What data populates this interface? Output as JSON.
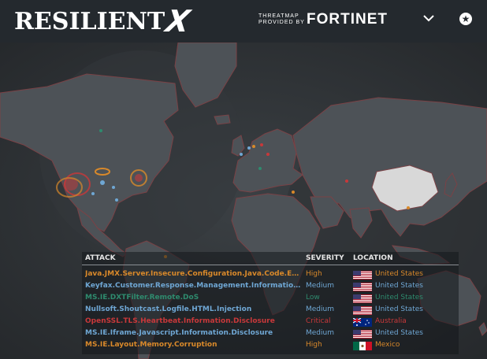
{
  "header": {
    "logo_text": "RESILIENT",
    "logo_x": "X",
    "provided_line1": "THREATMAP",
    "provided_line2": "PROVIDED BY",
    "brand": "FORTINET",
    "menu_icon": "chevron-down-icon",
    "badge_icon": "star-badge-icon"
  },
  "table": {
    "headers": [
      "ATTACK",
      "SEVERITY",
      "LOCATION"
    ],
    "rows": [
      {
        "attack": "Java.JMX.Server.Insecure.Configuration.Java.Code.Execution",
        "severity": "High",
        "location": "United States",
        "flag": "us",
        "color": "#d9892a"
      },
      {
        "attack": "Keyfax.Customer.Response.Management.Information.Disclosure",
        "severity": "Medium",
        "location": "United States",
        "flag": "us",
        "color": "#6fa7d4"
      },
      {
        "attack": "MS.IE.DXTFilter.Remote.DoS",
        "severity": "Low",
        "location": "United States",
        "flag": "us",
        "color": "#2e8b6e"
      },
      {
        "attack": "Nullsoft.Shoutcast.Logfile.HTML.Injection",
        "severity": "Medium",
        "location": "United States",
        "flag": "us",
        "color": "#6fa7d4"
      },
      {
        "attack": "OpenSSL.TLS.Heartbeat.Information.Disclosure",
        "severity": "Critical",
        "location": "Australia",
        "flag": "au",
        "color": "#c8383a"
      },
      {
        "attack": "MS.IE.Iframe.Javascript.Information.Disclosure",
        "severity": "Medium",
        "location": "United States",
        "flag": "us",
        "color": "#6fa7d4"
      },
      {
        "attack": "MS.IE.Layout.Memory.Corruption",
        "severity": "High",
        "location": "Mexico",
        "flag": "mx",
        "color": "#d9892a"
      }
    ]
  }
}
